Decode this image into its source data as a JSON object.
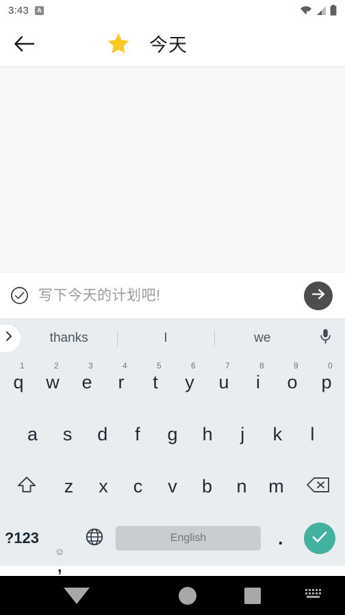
{
  "status_bar": {
    "time": "3:43",
    "notification_letter": "A",
    "icons": [
      "wifi-off-icon",
      "cellular-signal-icon",
      "battery-icon"
    ]
  },
  "app_bar": {
    "back_icon": "arrow-left-icon",
    "star_icon": "star-icon",
    "title": "今天",
    "star_color": "#f9ca24"
  },
  "task_input": {
    "checkbox_icon": "check-circle-icon",
    "placeholder": "写下今天的计划吧!",
    "value": "",
    "send_icon": "arrow-right-icon",
    "send_bg": "#4d4d4d"
  },
  "keyboard": {
    "expand_icon": "chevron-right-icon",
    "mic_icon": "microphone-icon",
    "suggestions": [
      "thanks",
      "I",
      "we"
    ],
    "row1": [
      {
        "key": "q",
        "num": "1"
      },
      {
        "key": "w",
        "num": "2"
      },
      {
        "key": "e",
        "num": "3"
      },
      {
        "key": "r",
        "num": "4"
      },
      {
        "key": "t",
        "num": "5"
      },
      {
        "key": "y",
        "num": "6"
      },
      {
        "key": "u",
        "num": "7"
      },
      {
        "key": "i",
        "num": "8"
      },
      {
        "key": "o",
        "num": "9"
      },
      {
        "key": "p",
        "num": "0"
      }
    ],
    "row2": [
      "a",
      "s",
      "d",
      "f",
      "g",
      "h",
      "j",
      "k",
      "l"
    ],
    "row3": [
      "z",
      "x",
      "c",
      "v",
      "b",
      "n",
      "m"
    ],
    "shift_icon": "shift-icon",
    "backspace_icon": "backspace-icon",
    "symbols_label": "?123",
    "emoji_icon": "emoji-smiley-icon",
    "comma_label": ",",
    "globe_icon": "globe-language-icon",
    "space_label": "English",
    "period_label": ".",
    "enter_icon": "check-icon",
    "enter_bg": "#43b1a0",
    "bg_color": "#e9edf0"
  },
  "nav_bar": {
    "back_icon": "triangle-down-icon",
    "home_icon": "circle-home-icon",
    "recents_icon": "square-recents-icon",
    "keyboard_switch_icon": "keyboard-icon"
  }
}
